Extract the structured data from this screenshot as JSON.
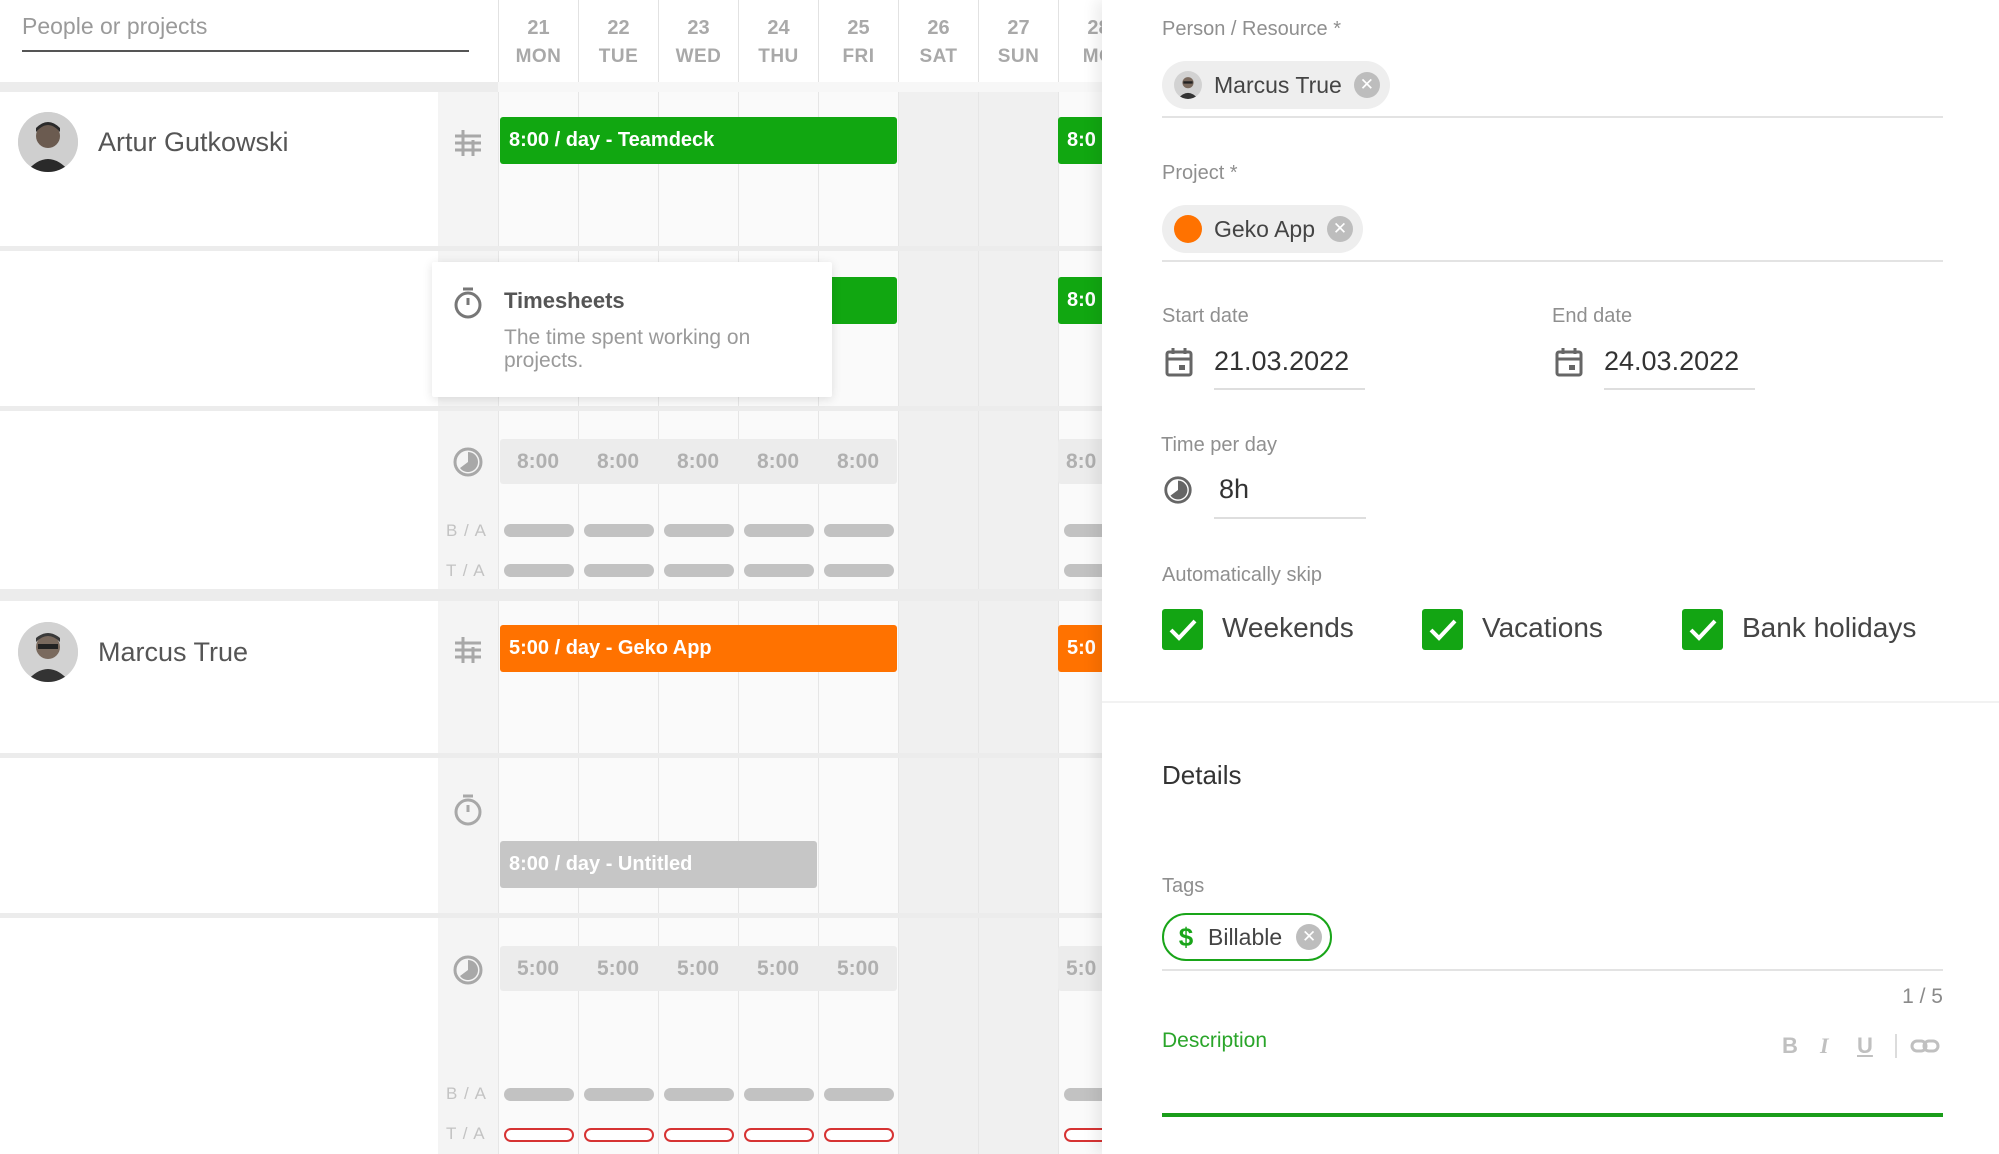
{
  "search": {
    "placeholder": "People or projects"
  },
  "days": [
    {
      "num": "21",
      "wd": "MON"
    },
    {
      "num": "22",
      "wd": "TUE"
    },
    {
      "num": "23",
      "wd": "WED"
    },
    {
      "num": "24",
      "wd": "THU"
    },
    {
      "num": "25",
      "wd": "FRI"
    },
    {
      "num": "26",
      "wd": "SAT"
    },
    {
      "num": "27",
      "wd": "SUN"
    },
    {
      "num": "28",
      "wd": "MO"
    }
  ],
  "people": [
    {
      "name": "Artur Gutkowski",
      "bar_label": "8:00 / day - Teamdeck",
      "bar_partial": "8:0",
      "second_partial": "8:0",
      "hours": [
        "8:00",
        "8:00",
        "8:00",
        "8:00",
        "8:00"
      ],
      "hours_partial": "8:0"
    },
    {
      "name": "Marcus True",
      "bar_label": "5:00 / day - Geko App",
      "bar_partial": "5:0",
      "untitled_label": "8:00 / day - Untitled",
      "hours": [
        "5:00",
        "5:00",
        "5:00",
        "5:00",
        "5:00"
      ],
      "hours_partial": "5:0"
    }
  ],
  "row_labels": {
    "ba": "B / A",
    "ta": "T / A"
  },
  "tooltip": {
    "title": "Timesheets",
    "description": "The time spent working on projects."
  },
  "panel": {
    "person_label": "Person / Resource *",
    "person_value": "Marcus True",
    "project_label": "Project *",
    "project_value": "Geko App",
    "project_color": "#ff7200",
    "start_label": "Start date",
    "start_value": "21.03.2022",
    "end_label": "End date",
    "end_value": "24.03.2022",
    "time_label": "Time per day",
    "time_value": "8h",
    "skip_label": "Automatically skip",
    "skip": [
      {
        "label": "Weekends",
        "checked": true
      },
      {
        "label": "Vacations",
        "checked": true
      },
      {
        "label": "Bank holidays",
        "checked": true
      }
    ],
    "details_title": "Details",
    "tags_label": "Tags",
    "tag_value": "Billable",
    "tags_counter": "1 / 5",
    "description_label": "Description",
    "format": {
      "bold": "B",
      "italic": "I",
      "underline": "U"
    }
  },
  "colors": {
    "green": "#11a711",
    "orange": "#ff7200",
    "accent": "#1a9d1a"
  }
}
